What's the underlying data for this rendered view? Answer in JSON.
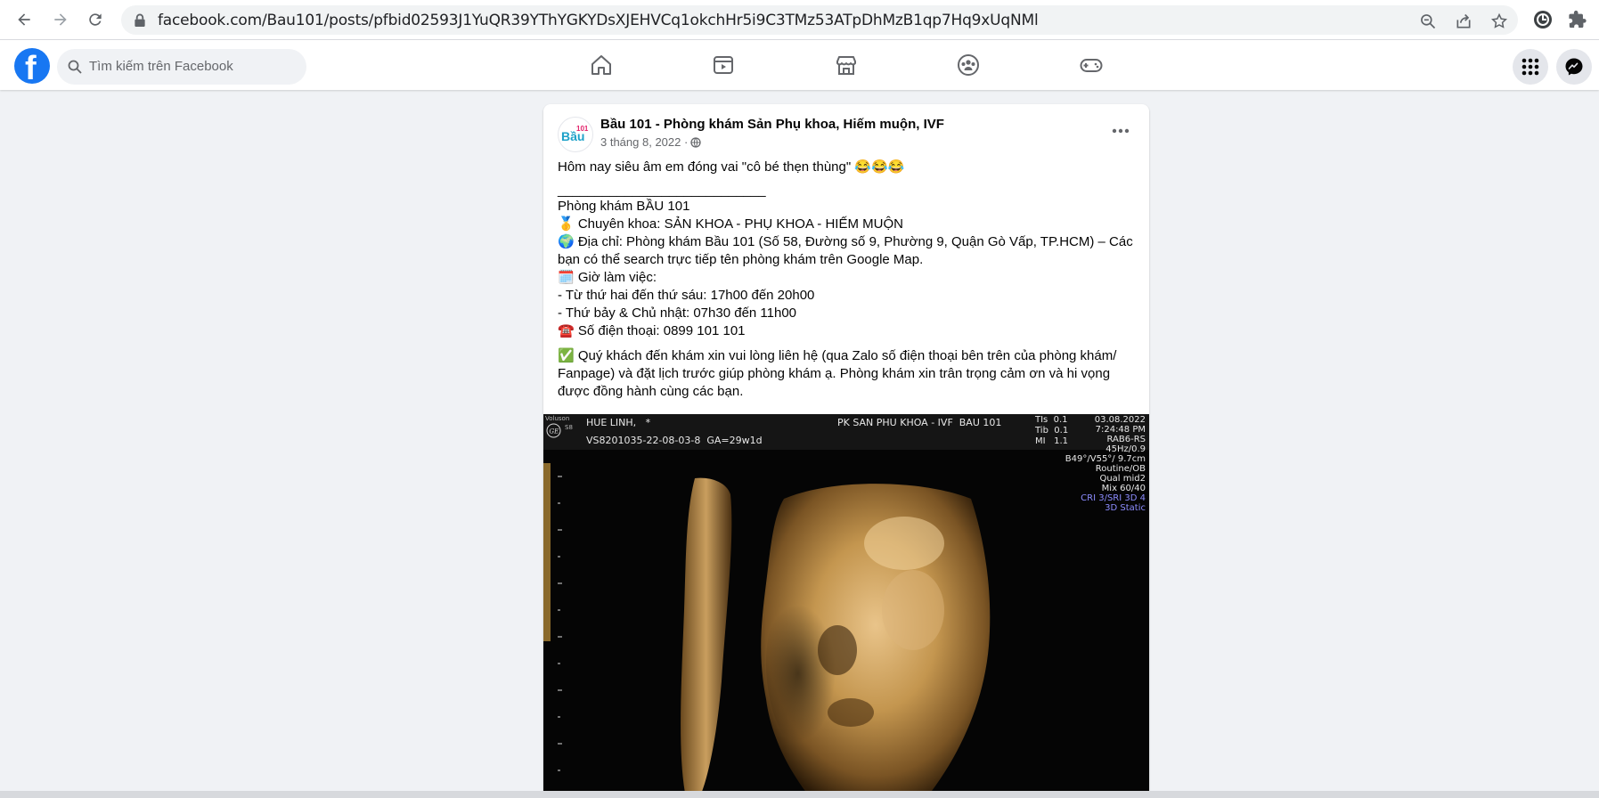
{
  "browser": {
    "url": "facebook.com/Bau101/posts/pfbid02593J1YuQR39YThYGKYDsXJEHVCq1okchHr5i9C3TMz53ATpDhMzB1qp7Hq9xUqNMl",
    "icons": [
      "back-icon",
      "forward-icon",
      "reload-icon",
      "lock-icon",
      "zoom-out-icon",
      "share-icon",
      "star-icon",
      "profile-extension-icon",
      "extensions-puzzle-icon"
    ]
  },
  "header": {
    "logo": "f",
    "search_placeholder": "Tìm kiếm trên Facebook",
    "nav_icons": [
      "home-icon",
      "watch-icon",
      "marketplace-icon",
      "groups-icon",
      "gaming-icon"
    ],
    "right_icons": [
      "menu-grid-icon",
      "messenger-icon"
    ]
  },
  "post": {
    "page_name": "Bầu 101 - Phòng khám Sản Phụ khoa, Hiếm muộn, IVF",
    "avatar_text": "Bầu",
    "avatar_badge": "101",
    "date": "3 tháng 8, 2022 ·",
    "lines": [
      "Hôm nay siêu âm em đóng vai \"cô bé thẹn thùng\" 😂😂😂",
      "",
      "____________________________",
      "Phòng khám BẦU 101",
      "🥇 Chuyên khoa: SẢN KHOA - PHỤ KHOA - HIẾM MUỘN",
      "🌍 Địa chỉ: Phòng khám Bầu 101 (Số 58, Đường số 9, Phường 9, Quận Gò Vấp, TP.HCM) – Các bạn có thể search trực tiếp tên phòng khám trên Google Map.",
      "🗓️ Giờ làm việc:",
      "- Từ thứ hai đến thứ sáu: 17h00 đến 20h00",
      "- Thứ bảy & Chủ nhật: 07h30 đến 11h00",
      "☎️ Số điện thoại: 0899 101 101"
    ],
    "note": "✅ Quý khách đến khám xin vui lòng liên hệ (qua Zalo số điện thoại bên trên của phòng khám/ Fanpage) và đặt lịch trước giúp phòng khám ạ. Phòng khám xin trân trọng cảm ơn và hi vọng được đồng hành cùng các bạn."
  },
  "ultrasound": {
    "brand": "Voluson",
    "model": "S8",
    "patient": "HUE LINH,   *",
    "id_line": "VS8201035-22-08-03-8  GA=29w1d",
    "clinic": "PK SAN PHU KHOA - IVF  BAU 101",
    "tis": "TIs  0.1",
    "tib": "Tib  0.1",
    "mi": "MI   1.1",
    "date": "03.08.2022",
    "time": "7:24:48 PM",
    "probe": "RAB6-RS",
    "freq": "45Hz/0.9",
    "angle": "B49°/V55°/ 9.7cm",
    "preset": "Routine/OB",
    "qual": "Qual mid2",
    "mix": "Mix 60/40",
    "cri": "CRI 3/SRI 3D 4",
    "mode": "3D Static"
  }
}
